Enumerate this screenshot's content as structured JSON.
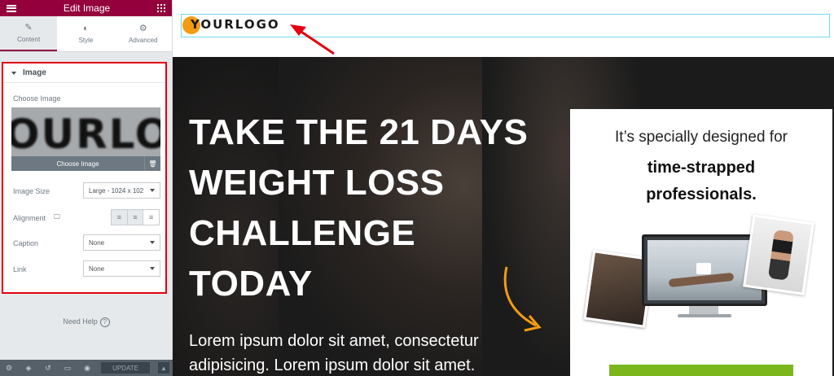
{
  "panel": {
    "title": "Edit Image",
    "tabs": [
      {
        "label": "Content",
        "icon": "pencil-icon"
      },
      {
        "label": "Style",
        "icon": "contrast-icon"
      },
      {
        "label": "Advanced",
        "icon": "gear-icon"
      }
    ],
    "section_title": "Image",
    "choose_image_label": "Choose Image",
    "preview_text": "OURLO",
    "choose_image_button": "Choose Image",
    "image_size_label": "Image Size",
    "image_size_value": "Large - 1024 x 102",
    "alignment_label": "Alignment",
    "caption_label": "Caption",
    "caption_value": "None",
    "link_label": "Link",
    "link_value": "None",
    "need_help": "Need Help",
    "update_label": "UPDATE"
  },
  "site": {
    "logo_text": "YOURLOGO",
    "headline_lines": [
      "TAKE THE 21 DAYS",
      "WEIGHT LOSS",
      "CHALLENGE",
      "TODAY"
    ],
    "body_lines": [
      "Lorem ipsum dolor sit amet, consectetur",
      "adipisicing. Lorem ipsum dolor sit amet."
    ],
    "card_line1": "It’s specially designed for",
    "card_line2a": "time-strapped",
    "card_line2b": "professionals."
  },
  "colors": {
    "panel_header": "#93003c",
    "highlight_border": "#e4000f",
    "logo_dot": "#f39c12",
    "annotation_arrow": "#e4000f",
    "hero_arrow": "#f39c12",
    "cta": "#7bb71c"
  }
}
